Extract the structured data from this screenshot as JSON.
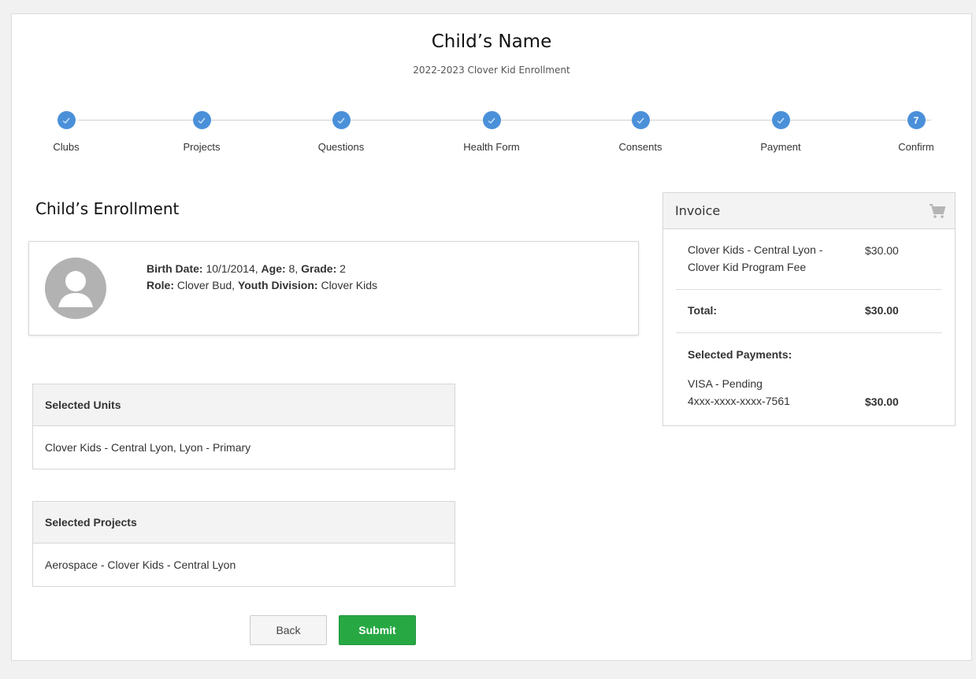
{
  "header": {
    "title": "Child’s Name",
    "subtitle": "2022-2023 Clover Kid Enrollment"
  },
  "steps": [
    {
      "label": "Clubs",
      "status": "complete"
    },
    {
      "label": "Projects",
      "status": "complete"
    },
    {
      "label": "Questions",
      "status": "complete"
    },
    {
      "label": "Health Form",
      "status": "complete"
    },
    {
      "label": "Consents",
      "status": "complete"
    },
    {
      "label": "Payment",
      "status": "complete"
    },
    {
      "label": "Confirm",
      "status": "current",
      "number": "7"
    }
  ],
  "enrollment": {
    "title": "Child’s Enrollment",
    "birth_date_label": "Birth Date:",
    "birth_date": "10/1/2014",
    "age_label": "Age:",
    "age": "8",
    "grade_label": "Grade:",
    "grade": "2",
    "role_label": "Role:",
    "role": "Clover Bud",
    "division_label": "Youth Division:",
    "division": "Clover Kids"
  },
  "units": {
    "header": "Selected Units",
    "value": "Clover Kids - Central Lyon, Lyon - Primary"
  },
  "projects": {
    "header": "Selected Projects",
    "value": "Aerospace - Clover Kids - Central Lyon"
  },
  "buttons": {
    "back": "Back",
    "submit": "Submit"
  },
  "invoice": {
    "title": "Invoice",
    "item_line1": "Clover Kids - Central Lyon -",
    "item_line2": "Clover Kid Program Fee",
    "item_amount": "$30.00",
    "total_label": "Total:",
    "total_amount": "$30.00",
    "payments_label": "Selected Payments:",
    "payment_line1": "VISA - Pending",
    "payment_line2": "4xxx-xxxx-xxxx-7561",
    "payment_amount": "$30.00"
  },
  "colors": {
    "step_complete": "#4a90d9",
    "submit_button": "#27a843"
  }
}
